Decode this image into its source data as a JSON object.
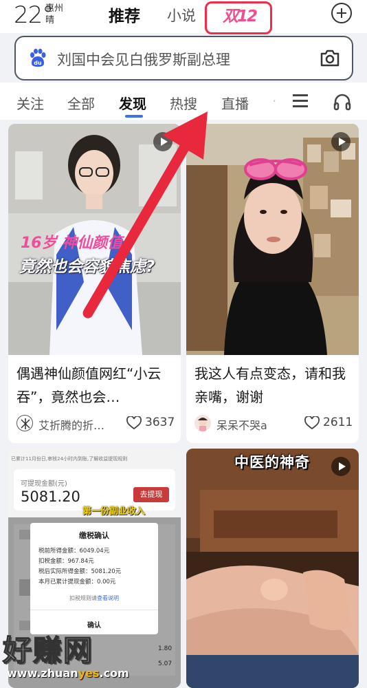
{
  "weather": {
    "temp": "22°",
    "city": "惠州",
    "condition": "晴"
  },
  "nav": {
    "recommend": "推荐",
    "novel": "小说",
    "promo": "双12"
  },
  "search": {
    "query": "刘国中会见白俄罗斯副总理"
  },
  "tabs": [
    {
      "label": "关注"
    },
    {
      "label": "全部"
    },
    {
      "label": "发现"
    },
    {
      "label": "热搜"
    },
    {
      "label": "直播"
    }
  ],
  "cards": [
    {
      "title": "偶遇神仙颜值网红“小云吞”，竟然也会…",
      "author": "艾折腾的折…",
      "likes": "3637",
      "overlay_line1": "16岁  神仙颜值",
      "overlay_line2": "竟然也会容貌焦虑?"
    },
    {
      "title": "我这人有点变态，请和我亲嘴，谢谢",
      "author": "呆呆不哭a",
      "likes": "2611"
    },
    {
      "header_text": "已累计11月份日,审核24小时内到账,了解收益提现规则",
      "balance_label": "可提现金额(元)",
      "balance": "5081.20",
      "withdraw_btn": "去提现",
      "income_caption": "第一份副业收入",
      "dialog_title": "缴税确认",
      "dialog_lines": [
        "税前所得金额：6049.04元",
        "扣税金额：967.84元",
        "税后实际所得金额：5081.20元",
        "本月已累计提现金额：0.00元"
      ],
      "dialog_rule": "扣税规则请",
      "dialog_rule_link": "查看说明",
      "dialog_confirm": "确认",
      "side_vals": [
        "1.80",
        "5.07"
      ]
    },
    {
      "overlay_title": "中医的神奇"
    }
  ],
  "watermark": {
    "title": "好赚网",
    "url_pre": "www.zhuan",
    "url_hl": "yes",
    "url_post": ".com"
  },
  "colors": {
    "accent": "#3b6ff5",
    "promo_border": "#f02c4a",
    "arrow": "#e8283c"
  }
}
